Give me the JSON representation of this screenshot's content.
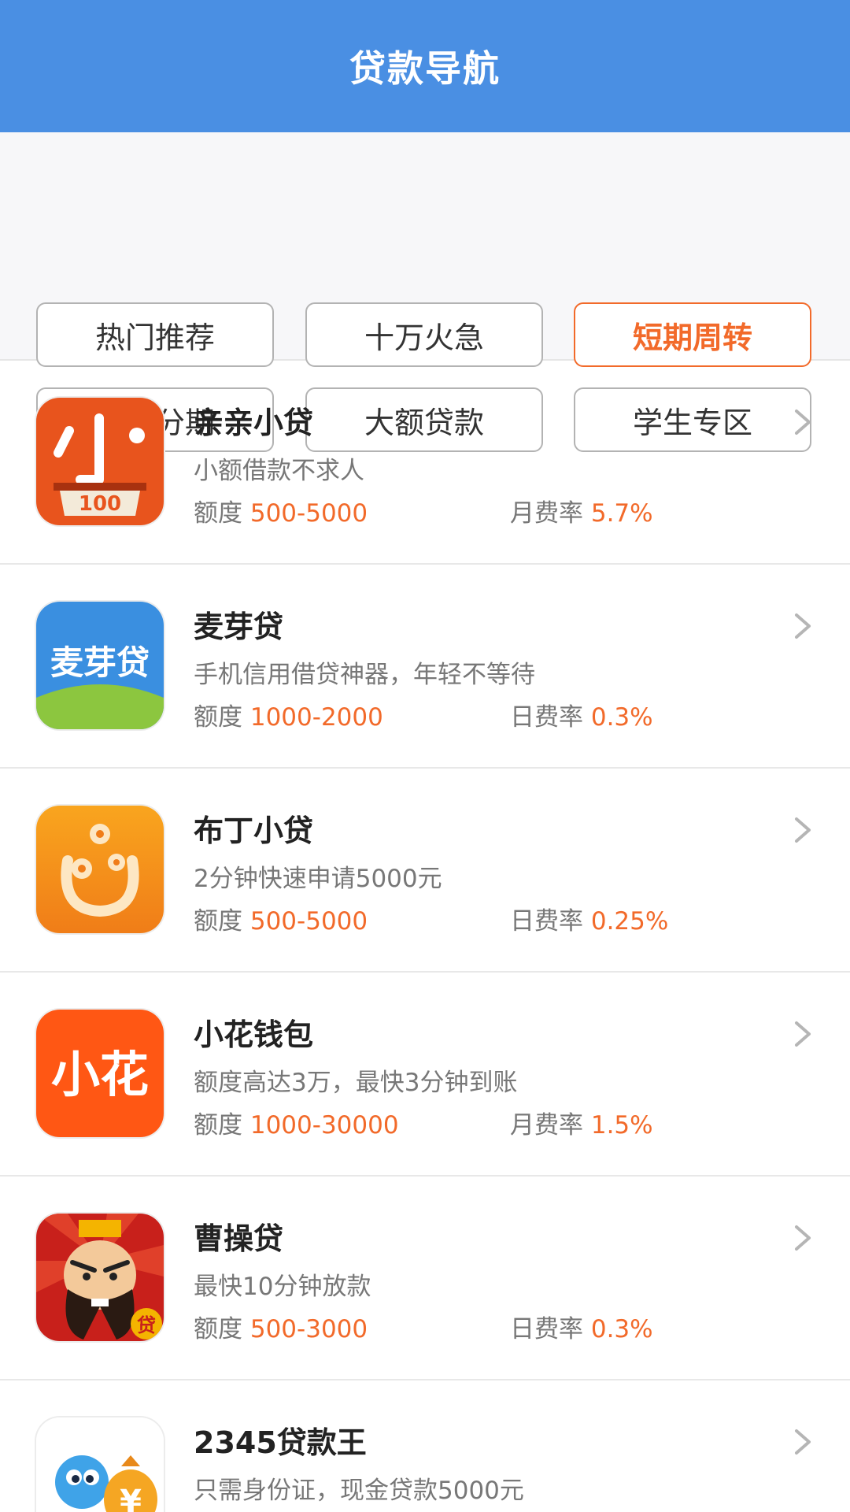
{
  "header": {
    "title": "贷款导航"
  },
  "filters": [
    {
      "label": "热门推荐",
      "active": false
    },
    {
      "label": "十万火急",
      "active": false
    },
    {
      "label": "短期周转",
      "active": true
    },
    {
      "label": "现金分期",
      "active": false
    },
    {
      "label": "大额贷款",
      "active": false
    },
    {
      "label": "学生专区",
      "active": false
    }
  ],
  "colors": {
    "header": "#4a8fe3",
    "accent": "#f26a2a"
  },
  "loans": [
    {
      "name": "亲亲小贷",
      "desc": "小额借款不求人",
      "amount_label": "额度",
      "amount": "500-5000",
      "rate_label": "月费率",
      "rate": "5.7%",
      "icon": "qinqin-icon",
      "icon_text": "100"
    },
    {
      "name": "麦芽贷",
      "desc": "手机信用借贷神器，年轻不等待",
      "amount_label": "额度",
      "amount": "1000-2000",
      "rate_label": "日费率",
      "rate": "0.3%",
      "icon": "maiya-icon",
      "icon_text": "麦芽贷"
    },
    {
      "name": "布丁小贷",
      "desc": "2分钟快速申请5000元",
      "amount_label": "额度",
      "amount": "500-5000",
      "rate_label": "日费率",
      "rate": "0.25%",
      "icon": "buding-icon"
    },
    {
      "name": "小花钱包",
      "desc": "额度高达3万，最快3分钟到账",
      "amount_label": "额度",
      "amount": "1000-30000",
      "rate_label": "月费率",
      "rate": "1.5%",
      "icon": "xiaohua-icon",
      "icon_text": "小花"
    },
    {
      "name": "曹操贷",
      "desc": "最快10分钟放款",
      "amount_label": "额度",
      "amount": "500-3000",
      "rate_label": "日费率",
      "rate": "0.3%",
      "icon": "caocao-icon",
      "icon_text": "贷"
    },
    {
      "name": "2345贷款王",
      "desc": "只需身份证，现金贷款5000元",
      "amount_label": "",
      "amount": "",
      "rate_label": "",
      "rate": "",
      "icon": "daikuanwang-icon",
      "icon_text": "¥"
    }
  ]
}
